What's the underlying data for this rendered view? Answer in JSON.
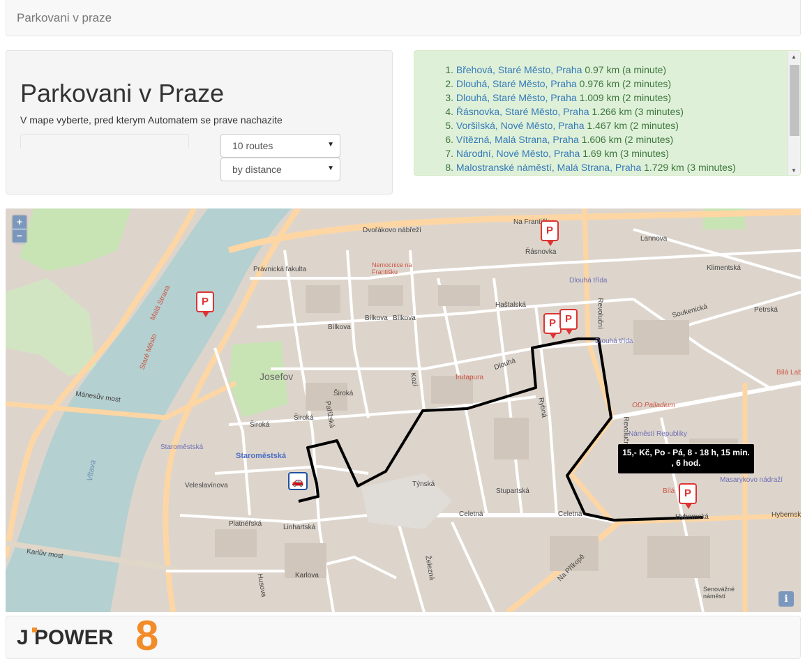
{
  "navbar": {
    "brand": "Parkovani v praze"
  },
  "header": {
    "title": "Parkovani v Praze",
    "lead": "V mape vyberte, pred kterym Automatem se prave nachazite",
    "routes_select": "10 routes",
    "sort_select": "by distance"
  },
  "results": [
    {
      "num": "1.",
      "place": "Břehová, Staré Město, Praha",
      "info": " 0.97 km (a minute)"
    },
    {
      "num": "2.",
      "place": "Dlouhá, Staré Město, Praha",
      "info": " 0.976 km (2 minutes)"
    },
    {
      "num": "3.",
      "place": "Dlouhá, Staré Město, Praha",
      "info": " 1.009 km (2 minutes)"
    },
    {
      "num": "4.",
      "place": "Řásnovka, Staré Město, Praha",
      "info": " 1.266 km (3 minutes)"
    },
    {
      "num": "5.",
      "place": "Voršilská, Nové Město, Praha",
      "info": " 1.467 km (2 minutes)"
    },
    {
      "num": "6.",
      "place": "Vítězná, Malá Strana, Praha",
      "info": " 1.606 km (2 minutes)"
    },
    {
      "num": "7.",
      "place": "Národní, Nové Město, Praha",
      "info": " 1.69 km (3 minutes)"
    },
    {
      "num": "8.",
      "place": "Malostranské náměstí, Malá Strana, Praha",
      "info": " 1.729 km (3 minutes)"
    }
  ],
  "map": {
    "zoom_in": "+",
    "zoom_out": "−",
    "info": "i",
    "tooltip_line1": "15,- Kč, Po - Pá, 8 - 18 h, 15 min.",
    "tooltip_line2": ", 6 hod.",
    "pin_text": "P",
    "labels": {
      "dvorakovo": "Dvořákovo nábřeží",
      "rasnovka": "Řásnovka",
      "na_frantisku": "Na Františku",
      "josefov": "Josefov",
      "staromestska": "Staroměstská",
      "vltava": "Vltava",
      "manesuv": "Mánesův most",
      "karluv": "Karlův most",
      "celetna": "Celetná",
      "dlouha_trida": "Dlouhá třída",
      "dlouha": "Dlouhá",
      "od_palladium": "OD Palladium",
      "namesti_republiky": "Náměstí Republiky",
      "masarykovo": "Masarykovo nádraží",
      "hybernska": "Hybernská",
      "revolucni": "Revoluční",
      "pravnicka": "Právnická fakulta",
      "nemocnice": "Nemocnice na Františku",
      "platnerska": "Platnéřská",
      "linhartska": "Linhartská",
      "veleslavinova": "Veleslavínova",
      "siroka": "Široká",
      "parizska": "Pařížská",
      "tynska": "Týnská",
      "stupartska": "Stupartská",
      "na_prikope": "Na Příkopě",
      "zelezna": "Železná",
      "karlova": "Karlova",
      "husova": "Husova",
      "kozi": "Kozí",
      "rybna": "Rybná",
      "petrska": "Petrská",
      "soukenicka": "Soukenická",
      "klimentska": "Klimentská",
      "lannova": "Lannova",
      "hastalska": "Haštalská",
      "bilkova": "Bílkova",
      "stare_mesto": "Staré Město",
      "mala_strana": "Malá Strana",
      "frutapura": "frutapura",
      "bila_labut": "Bílá Lab",
      "bila": "Bílá",
      "senovazne": "Senovážné náměstí"
    }
  },
  "footer": {
    "logo_text": "J POWER",
    "logo_digit": "8"
  },
  "colors": {
    "route": "#000000",
    "river": "#b5d0d0",
    "road_major": "#fdd6a4",
    "road_minor": "#ffffff",
    "building": "#d9d0c9",
    "park": "#c8e3b4"
  }
}
